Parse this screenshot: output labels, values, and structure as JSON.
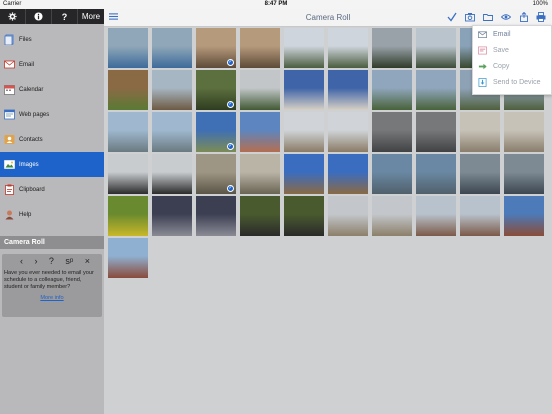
{
  "status": {
    "carrier": "Carrier",
    "time": "8:47 PM",
    "battery": "100%"
  },
  "sidebar": {
    "top_buttons": {
      "settings_icon": "gear-icon",
      "info_icon": "info-icon",
      "help_label": "?",
      "more_label": "More"
    },
    "items": [
      {
        "label": "Files",
        "icon": "files-icon"
      },
      {
        "label": "Email",
        "icon": "email-icon"
      },
      {
        "label": "Calendar",
        "icon": "calendar-icon"
      },
      {
        "label": "Web pages",
        "icon": "web-icon"
      },
      {
        "label": "Contacts",
        "icon": "contacts-icon"
      },
      {
        "label": "Images",
        "icon": "images-icon",
        "active": true
      },
      {
        "label": "Clipboard",
        "icon": "clipboard-icon"
      },
      {
        "label": "Help",
        "icon": "help-icon"
      }
    ],
    "roll_header": "Camera Roll",
    "info": {
      "controls": [
        "‹",
        "›",
        "?",
        "sᵖ",
        "×"
      ],
      "text": "Have you ever needed to email your schedule to a colleague, friend, student or family member?",
      "link": "More info"
    }
  },
  "main": {
    "title": "Camera Roll",
    "menu_icon": "menu-icon",
    "toolbar_icons": [
      "checkmark-icon",
      "camera-icon",
      "folder-icon",
      "eye-icon",
      "share-icon",
      "print-icon"
    ]
  },
  "dropdown": {
    "items": [
      {
        "label": "Email",
        "icon": "email-icon"
      },
      {
        "label": "Save",
        "icon": "save-icon"
      },
      {
        "label": "Copy",
        "icon": "copy-icon"
      },
      {
        "label": "Send to Device",
        "icon": "device-icon"
      }
    ]
  },
  "photos": [
    {
      "c1": "#8fa7b8",
      "c2": "#3d6b9a",
      "checked": false
    },
    {
      "c1": "#8fa7b8",
      "c2": "#3d6b9a",
      "checked": false
    },
    {
      "c1": "#b69a7c",
      "c2": "#5d4a38",
      "checked": true
    },
    {
      "c1": "#b69a7c",
      "c2": "#5d4a38",
      "checked": false
    },
    {
      "c1": "#cfd5dc",
      "c2": "#4a5d3f",
      "checked": false
    },
    {
      "c1": "#cfd5dc",
      "c2": "#4a5d3f",
      "checked": false
    },
    {
      "c1": "#9aa2a9",
      "c2": "#2f3b2a",
      "checked": false
    },
    {
      "c1": "#b9c4cc",
      "c2": "#3b4c36",
      "checked": false
    },
    {
      "c1": "#8aa2b8",
      "c2": "#38482e",
      "checked": false
    },
    {
      "c1": "#9ab0c4",
      "c2": "#405038",
      "checked": false
    },
    {
      "c1": "#8a6a45",
      "c2": "#5a7a35",
      "checked": false
    },
    {
      "c1": "#a7b6c3",
      "c2": "#6d5a43",
      "checked": false
    },
    {
      "c1": "#5c6f3e",
      "c2": "#2e3d20",
      "checked": true
    },
    {
      "c1": "#c2c6c8",
      "c2": "#415a34",
      "checked": false
    },
    {
      "c1": "#3f64a8",
      "c2": "#d7d0c5",
      "checked": false
    },
    {
      "c1": "#3f64a8",
      "c2": "#d7d0c5",
      "checked": false
    },
    {
      "c1": "#90a6bc",
      "c2": "#48623a",
      "checked": false
    },
    {
      "c1": "#90a6bc",
      "c2": "#48623a",
      "checked": false
    },
    {
      "c1": "#8ea2b6",
      "c2": "#4f5f3d",
      "checked": false
    },
    {
      "c1": "#8ea2b6",
      "c2": "#4f5f3d",
      "checked": false
    },
    {
      "c1": "#9fb8cf",
      "c2": "#6a7a80",
      "checked": false
    },
    {
      "c1": "#9fb8cf",
      "c2": "#6a7a80",
      "checked": false
    },
    {
      "c1": "#3f6fb5",
      "c2": "#7c8b55",
      "checked": true
    },
    {
      "c1": "#5d86c0",
      "c2": "#b46e50",
      "checked": false
    },
    {
      "c1": "#d0d4d8",
      "c2": "#8a7b66",
      "checked": false
    },
    {
      "c1": "#d0d4d8",
      "c2": "#8a7b66",
      "checked": false
    },
    {
      "c1": "#77787a",
      "c2": "#404244",
      "checked": false
    },
    {
      "c1": "#77787a",
      "c2": "#404244",
      "checked": false
    },
    {
      "c1": "#c7c2b8",
      "c2": "#8a7e6c",
      "checked": false
    },
    {
      "c1": "#c7c2b8",
      "c2": "#8a7e6c",
      "checked": false
    },
    {
      "c1": "#c8cccf",
      "c2": "#2b2b2b",
      "checked": false
    },
    {
      "c1": "#c8cccf",
      "c2": "#2b2b2b",
      "checked": false
    },
    {
      "c1": "#9e9684",
      "c2": "#5a5447",
      "checked": true
    },
    {
      "c1": "#b9b4a5",
      "c2": "#6a6455",
      "checked": false
    },
    {
      "c1": "#3a6cc0",
      "c2": "#8a6a45",
      "checked": false
    },
    {
      "c1": "#3a6cc0",
      "c2": "#8a6a45",
      "checked": false
    },
    {
      "c1": "#6a88a3",
      "c2": "#50606b",
      "checked": false
    },
    {
      "c1": "#6a88a3",
      "c2": "#50606b",
      "checked": false
    },
    {
      "c1": "#7e8a93",
      "c2": "#3b4650",
      "checked": false
    },
    {
      "c1": "#7e8a93",
      "c2": "#3b4650",
      "checked": false
    },
    {
      "c1": "#6a8a2f",
      "c2": "#c8b82a",
      "checked": false
    },
    {
      "c1": "#3c3f52",
      "c2": "#8a8b95",
      "checked": false
    },
    {
      "c1": "#3c3f52",
      "c2": "#8a8b95",
      "checked": false
    },
    {
      "c1": "#4a5a2f",
      "c2": "#2a2a2a",
      "checked": false
    },
    {
      "c1": "#4a5a2f",
      "c2": "#2a2a2a",
      "checked": false
    },
    {
      "c1": "#c3c7cb",
      "c2": "#8c7f6a",
      "checked": false
    },
    {
      "c1": "#c3c7cb",
      "c2": "#8c7f6a",
      "checked": false
    },
    {
      "c1": "#b8c2cc",
      "c2": "#7c5a48",
      "checked": false
    },
    {
      "c1": "#b8c2cc",
      "c2": "#7c5a48",
      "checked": false
    },
    {
      "c1": "#4d7ab8",
      "c2": "#8a4c38",
      "checked": false
    },
    {
      "c1": "#8fb0d0",
      "c2": "#8a4a3a",
      "checked": false
    }
  ]
}
